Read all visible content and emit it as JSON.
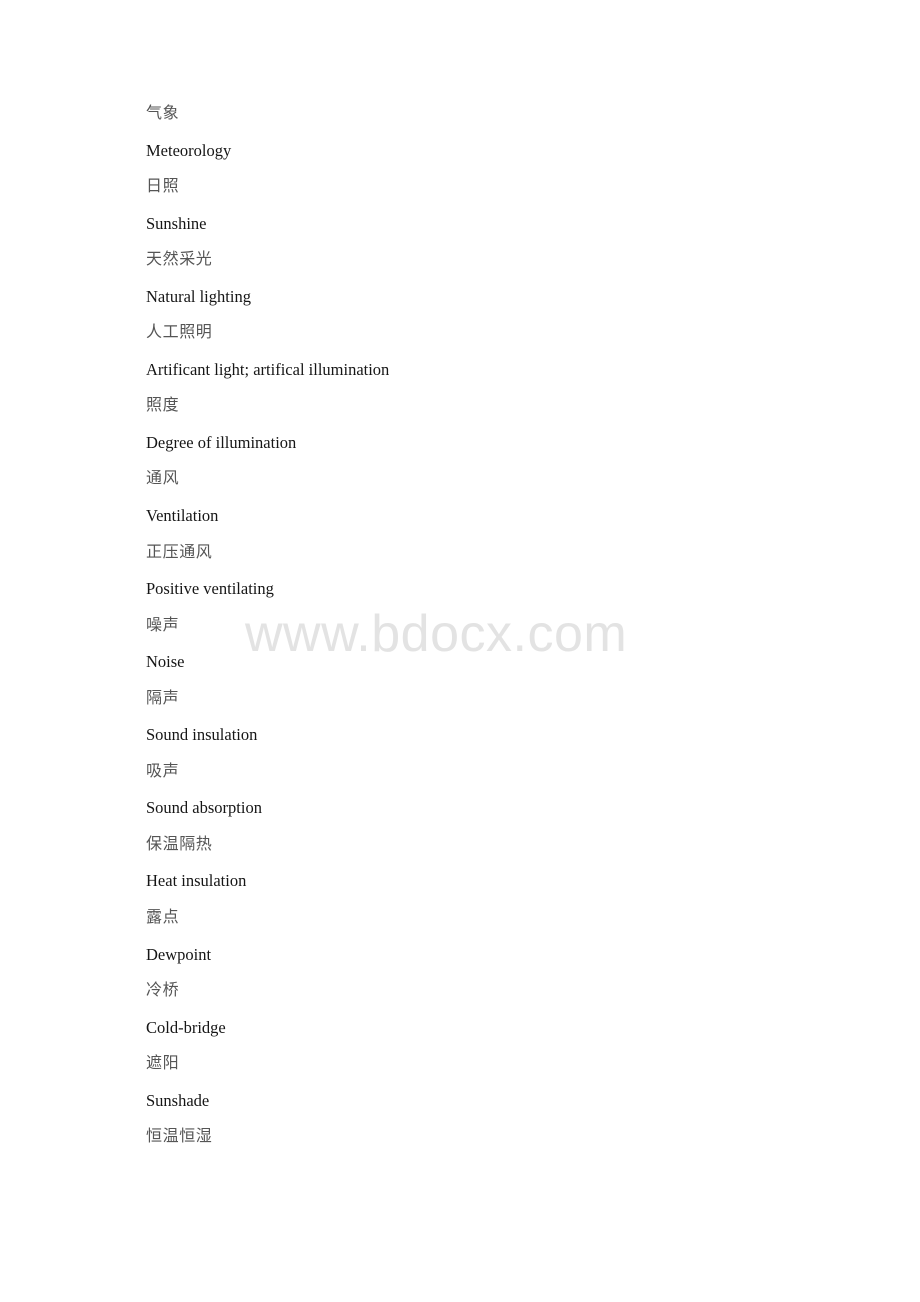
{
  "watermark": {
    "text": "www.bdocx.com",
    "color": "#e3e3e3"
  },
  "document": {
    "type": "bilingual-glossary",
    "subject": "Building physics / architectural environment terms",
    "colors": {
      "chinese_text": "#555555",
      "english_text": "#161616",
      "page_background": "#ffffff"
    },
    "entries": [
      {
        "zh": "气象",
        "en": "Meteorology"
      },
      {
        "zh": "日照",
        "en": "Sunshine"
      },
      {
        "zh": "天然采光",
        "en": "Natural lighting"
      },
      {
        "zh": "人工照明",
        "en": "Artificant light; artifical illumination"
      },
      {
        "zh": "照度",
        "en": "Degree of illumination"
      },
      {
        "zh": "通风",
        "en": "Ventilation"
      },
      {
        "zh": "正压通风",
        "en": "Positive ventilating"
      },
      {
        "zh": "噪声",
        "en": "Noise"
      },
      {
        "zh": "隔声",
        "en": "Sound insulation"
      },
      {
        "zh": "吸声",
        "en": "Sound absorption"
      },
      {
        "zh": "保温隔热",
        "en": "Heat insulation"
      },
      {
        "zh": "露点",
        "en": "Dewpoint"
      },
      {
        "zh": "冷桥",
        "en": "Cold-bridge"
      },
      {
        "zh": "遮阳",
        "en": "Sunshade"
      },
      {
        "zh": "恒温恒湿",
        "en": null
      }
    ]
  }
}
